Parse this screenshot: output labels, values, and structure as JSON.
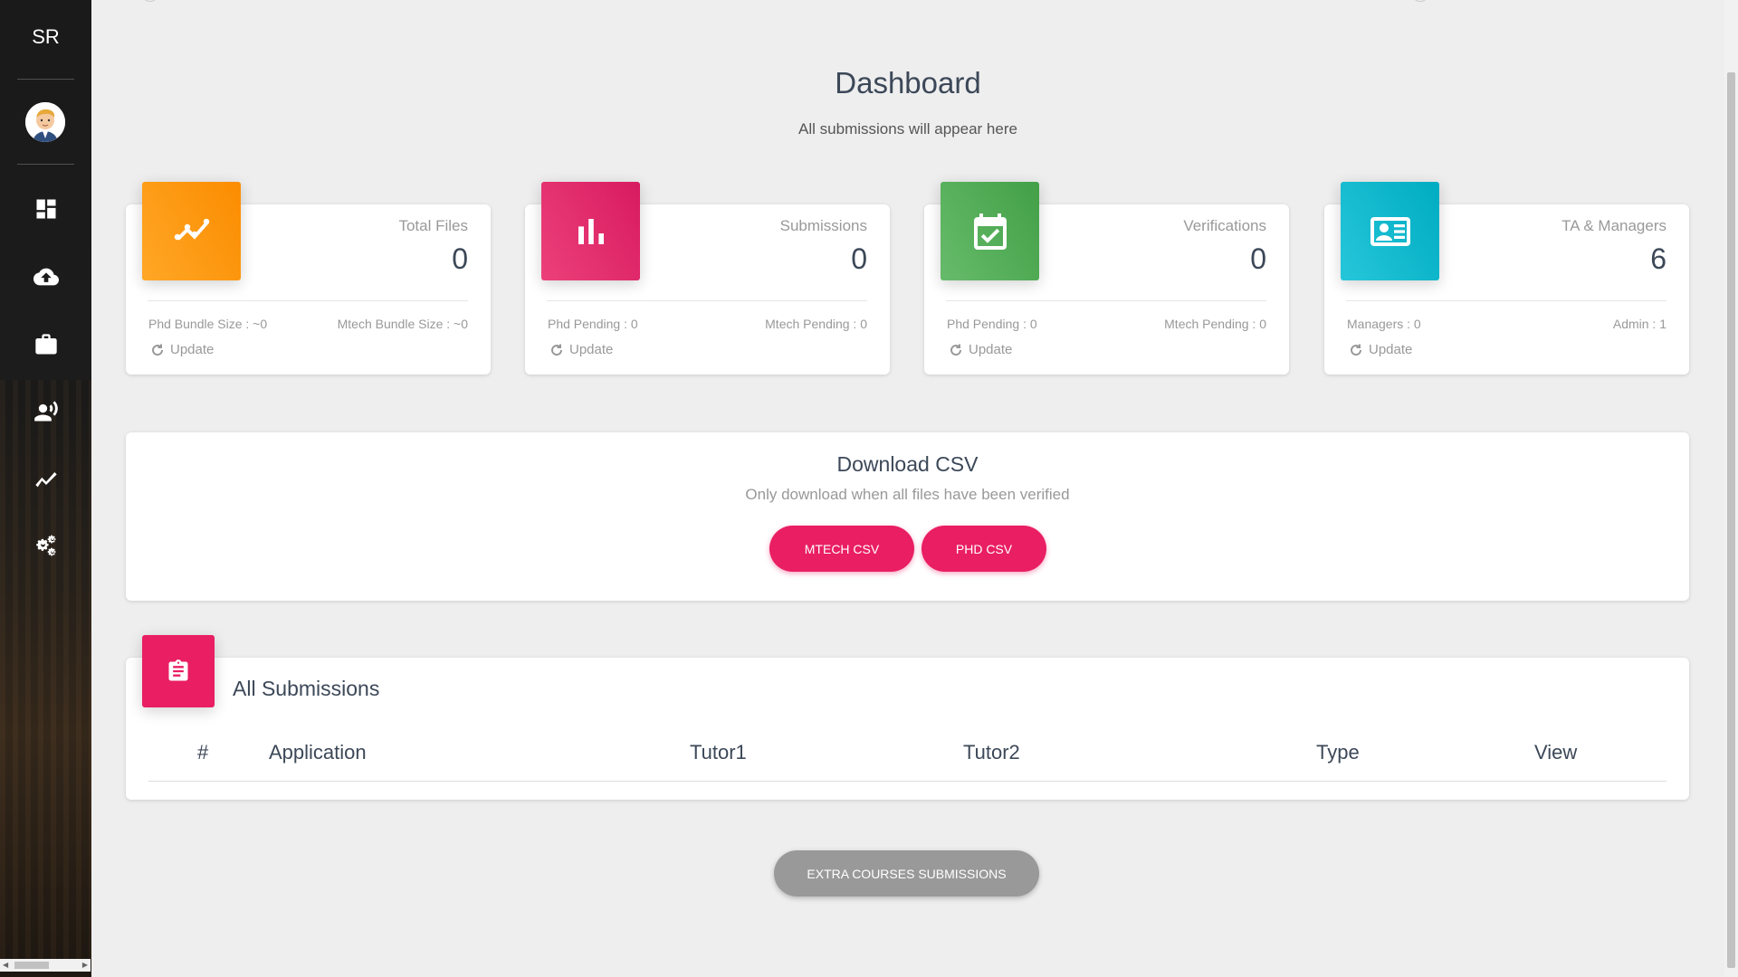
{
  "app": {
    "logo_text": "SR"
  },
  "sidebar": {
    "items": [
      {
        "name": "dashboard",
        "icon": "dashboard-icon"
      },
      {
        "name": "upload",
        "icon": "cloud-upload-icon"
      },
      {
        "name": "work",
        "icon": "briefcase-icon"
      },
      {
        "name": "record-voice",
        "icon": "record-voice-icon"
      },
      {
        "name": "timeline",
        "icon": "trending-icon"
      },
      {
        "name": "settings",
        "icon": "gears-icon"
      }
    ]
  },
  "header": {
    "title": "Dashboard",
    "subtitle": "All submissions will appear here"
  },
  "stats": [
    {
      "label": "Total Files",
      "value": "0",
      "foot_left": "Phd Bundle Size : ~0",
      "foot_right": "Mtech Bundle Size : ~0",
      "update": "Update",
      "color": "#fb8c00",
      "icon": "trending-icon"
    },
    {
      "label": "Submissions",
      "value": "0",
      "foot_left": "Phd Pending : 0",
      "foot_right": "Mtech Pending : 0",
      "update": "Update",
      "color": "#e91e63",
      "icon": "bar-chart-icon"
    },
    {
      "label": "Verifications",
      "value": "0",
      "foot_left": "Phd Pending : 0",
      "foot_right": "Mtech Pending : 0",
      "update": "Update",
      "color": "#4caf50",
      "icon": "calendar-check-icon"
    },
    {
      "label": "TA & Managers",
      "value": "6",
      "foot_left": "Managers : 0",
      "foot_right": "Admin : 1",
      "update": "Update",
      "color": "#00bcd4",
      "icon": "id-card-icon"
    }
  ],
  "csv": {
    "title": "Download CSV",
    "subtitle": "Only download when all files have been verified",
    "mtech_button": "MTECH CSV",
    "phd_button": "PHD CSV"
  },
  "submissions": {
    "title": "All Submissions",
    "columns": [
      "#",
      "Application",
      "Tutor1",
      "Tutor2",
      "Type",
      "View"
    ]
  },
  "extra_button": "EXTRA COURSES SUBMISSIONS",
  "colors": {
    "accent": "#e91e63",
    "grey_button": "#999999"
  }
}
